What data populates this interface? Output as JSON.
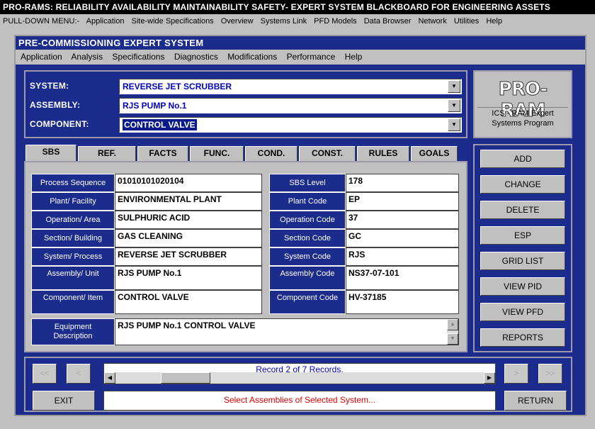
{
  "app_title": "PRO-RAMS: RELIABILITY AVAILABILITY MAINTAINABILITY SAFETY- EXPERT SYSTEM BLACKBOARD FOR ENGINEERING ASSETS",
  "top_menu": [
    "PULL-DOWN MENU:-",
    "Application",
    "Site-wide Specifications",
    "Overview",
    "Systems Link",
    "PFD Models",
    "Data Browser",
    "Network",
    "Utilities",
    "Help"
  ],
  "window": {
    "title": "PRE-COMMISSIONING EXPERT SYSTEM",
    "menu": [
      "Application",
      "Analysis",
      "Specifications",
      "Diagnostics",
      "Modifications",
      "Performance",
      "Help"
    ]
  },
  "selectors": {
    "system": {
      "label": "SYSTEM:",
      "value": "REVERSE JET SCRUBBER"
    },
    "assembly": {
      "label": "ASSEMBLY:",
      "value": "RJS PUMP No.1"
    },
    "component": {
      "label": "COMPONENT:",
      "value": "CONTROL VALVE"
    }
  },
  "logo": {
    "text": "PRO-RAM",
    "subtitle_line1": "ICS - RAM Expert",
    "subtitle_line2": "Systems Program"
  },
  "tabs": [
    "SBS",
    "REF.",
    "FACTS",
    "FUNC.",
    "COND.",
    "CONST.",
    "RULES",
    "GOALS"
  ],
  "active_tab": "SBS",
  "fields_left": [
    {
      "label": "Process Sequence",
      "value": "01010101020104"
    },
    {
      "label": "Plant/ Facility",
      "value": "ENVIRONMENTAL PLANT"
    },
    {
      "label": "Operation/ Area",
      "value": "SULPHURIC ACID"
    },
    {
      "label": "Section/ Building",
      "value": "GAS CLEANING"
    },
    {
      "label": "System/ Process",
      "value": "REVERSE JET SCRUBBER"
    },
    {
      "label": "Assembly/ Unit",
      "value": "RJS PUMP No.1"
    },
    {
      "label": "Component/ Item",
      "value": "CONTROL VALVE"
    }
  ],
  "fields_right": [
    {
      "label": "SBS Level",
      "value": "178"
    },
    {
      "label": "Plant Code",
      "value": "EP"
    },
    {
      "label": "Operation Code",
      "value": "37"
    },
    {
      "label": "Section Code",
      "value": "GC"
    },
    {
      "label": "System Code",
      "value": "RJS"
    },
    {
      "label": "Assembly Code",
      "value": "NS37-07-101"
    },
    {
      "label": "Component Code",
      "value": "HV-37185"
    }
  ],
  "equipment": {
    "label_line1": "Equipment",
    "label_line2": "Description",
    "value": "RJS PUMP No.1 CONTROL VALVE"
  },
  "side_buttons": [
    "ADD",
    "CHANGE",
    "DELETE",
    "ESP",
    "GRID LIST",
    "VIEW PID",
    "VIEW PFD",
    "REPORTS"
  ],
  "nav": {
    "first": "<<",
    "prev": "<",
    "next": ">",
    "last": ">>",
    "record_text": "Record 2 of 7 Records.",
    "status_text": "Select Assemblies of Selected System...",
    "exit": "EXIT",
    "return": "RETURN"
  }
}
